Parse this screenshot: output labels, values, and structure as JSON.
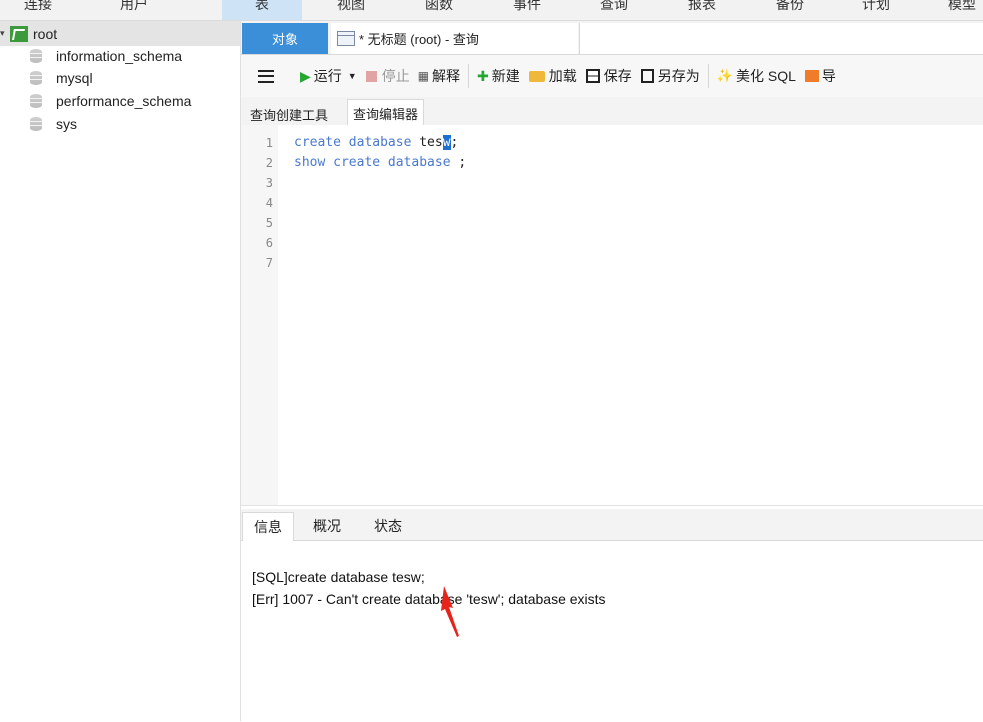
{
  "topnav": {
    "items": [
      "连接",
      "用户",
      "表",
      "视图",
      "函数",
      "事件",
      "查询",
      "报表",
      "备份",
      "计划",
      "模型"
    ]
  },
  "sidebar": {
    "connection": "root",
    "databases": [
      "information_schema",
      "mysql",
      "performance_schema",
      "sys"
    ]
  },
  "tabs": {
    "objects_label": "对象",
    "query_tab_title": "* 无标题 (root) - 查询"
  },
  "toolbar": {
    "run_label": "运行",
    "stop_label": "停止",
    "explain_label": "解释",
    "new_label": "新建",
    "load_label": "加载",
    "save_label": "保存",
    "save_as_label": "另存为",
    "beautify_label": "美化 SQL",
    "more_label": "导"
  },
  "subtabs": {
    "builder_label": "查询创建工具",
    "editor_label": "查询编辑器"
  },
  "editor": {
    "line_numbers": [
      "1",
      "2",
      "3",
      "4",
      "5",
      "6",
      "7"
    ],
    "line1": {
      "kw": "create database",
      "ident_before": "tes",
      "ident_cursor": "w",
      "end": ";"
    },
    "line2": {
      "kw": "show create database",
      "end": " ;"
    }
  },
  "result_tabs": {
    "info_label": "信息",
    "overview_label": "概况",
    "status_label": "状态"
  },
  "messages": {
    "sql_line": "[SQL]create database tesw;",
    "err_line": "[Err] 1007 - Can't create database 'tesw'; database exists"
  },
  "colors": {
    "accent_blue": "#3b8ed8",
    "run_green": "#22a82f",
    "stop_red": "#d9534f",
    "keyword_blue": "#4a78cc",
    "annotation_red": "#e8231a"
  }
}
